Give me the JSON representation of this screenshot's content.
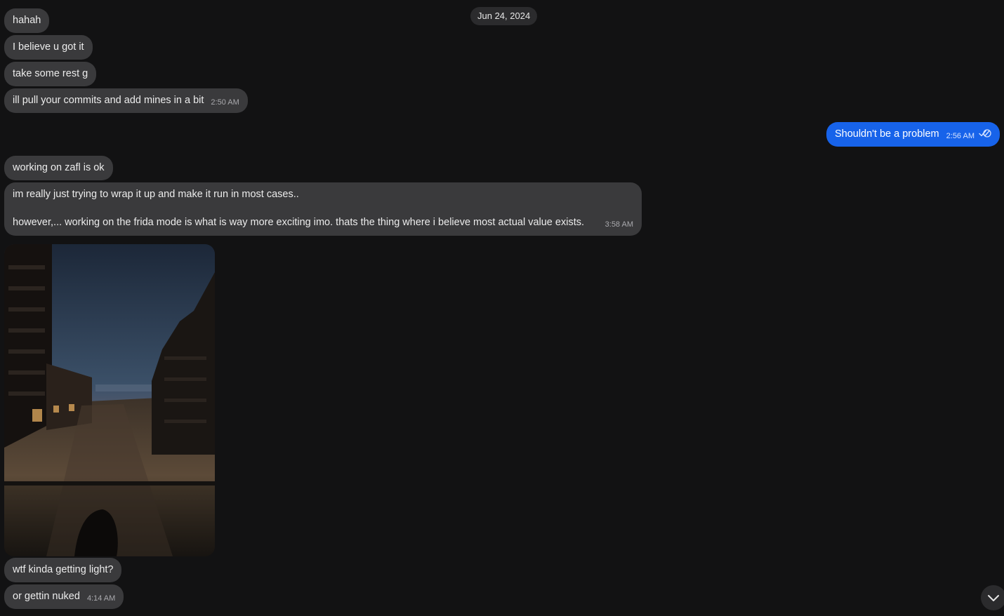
{
  "date_separator": "Jun 24, 2024",
  "messages": [
    {
      "text": "hahah",
      "time": "",
      "direction": "incoming"
    },
    {
      "text": "I believe u got it",
      "time": "",
      "direction": "incoming"
    },
    {
      "text": "take some rest g",
      "time": "",
      "direction": "incoming"
    },
    {
      "text": "ill pull your commits and add mines in a bit",
      "time": "2:50 AM",
      "direction": "incoming"
    },
    {
      "text": "Shouldn't be a problem",
      "time": "2:56 AM",
      "direction": "outgoing",
      "status_icon": "double-check-read-icon"
    },
    {
      "text": "working on zafl is ok",
      "time": "",
      "direction": "incoming"
    },
    {
      "lines": [
        "im really just trying to wrap it up and make it run in most cases..",
        "however,... working on the frida mode is what is way more exciting imo. thats the thing where i believe most actual value exists."
      ],
      "time": "3:58 AM",
      "direction": "incoming"
    },
    {
      "type": "photo",
      "direction": "incoming"
    },
    {
      "text": "wtf kinda getting light?",
      "time": "",
      "direction": "incoming"
    },
    {
      "text": "or gettin nuked",
      "time": "4:14 AM",
      "direction": "incoming"
    }
  ],
  "colors": {
    "background": "#121213",
    "incoming_bubble": "#3a3a3c",
    "outgoing_bubble": "#1763ea"
  },
  "scroll_button_icon": "chevron-down-icon"
}
